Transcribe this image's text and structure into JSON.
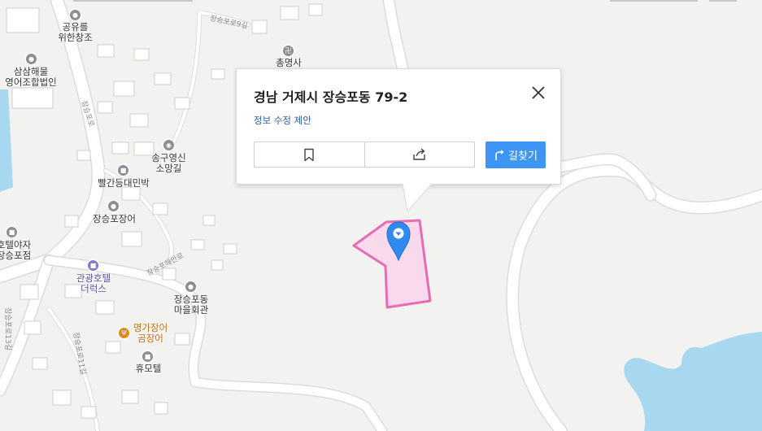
{
  "popup": {
    "address": "경남 거제시 장승포동 79-2",
    "edit_link": "정보 수정 제안",
    "route_button": "길찾기",
    "bookmark_icon": "bookmark-icon",
    "share_icon": "share-icon",
    "close_icon": "close-icon"
  },
  "colors": {
    "water": "#a8d8ef",
    "parcel_fill": "#f9d9ec",
    "parcel_stroke": "#e96bb3",
    "marker": "#2f8bf0",
    "route_button": "#3d95f5",
    "link": "#2c5fa8",
    "orange_label": "#c66a05",
    "purple_label": "#5f4fa0"
  },
  "pois": [
    {
      "name": "공유를\n위한창조",
      "icon": "building-icon",
      "style": "default"
    },
    {
      "name": "총명사",
      "icon": "temple-icon",
      "style": "default"
    },
    {
      "name": "삼삼해물\n영어조합법인",
      "icon": "building-icon",
      "style": "default"
    },
    {
      "name": "송구영신\n소망길",
      "icon": "camera-icon",
      "style": "default"
    },
    {
      "name": "빨간등대민박",
      "icon": "lodging-icon",
      "style": "default"
    },
    {
      "name": "장승포장어",
      "icon": "building-icon",
      "style": "default"
    },
    {
      "name": "호텔야자\n장승포점",
      "icon": "lodging-icon",
      "style": "default"
    },
    {
      "name": "관광호텔\n더럭스",
      "icon": "hotel-icon",
      "style": "purple"
    },
    {
      "name": "장승포동\n마을회관",
      "icon": "building-icon",
      "style": "default"
    },
    {
      "name": "명가장어\n곰장어",
      "icon": "restaurant-icon",
      "style": "orange"
    },
    {
      "name": "휴모텔",
      "icon": "lodging-icon",
      "style": "default"
    }
  ],
  "roads": [
    "장승포로9길",
    "장승포로",
    "장승포해안로",
    "장승포로13길",
    "장승포로11길"
  ]
}
